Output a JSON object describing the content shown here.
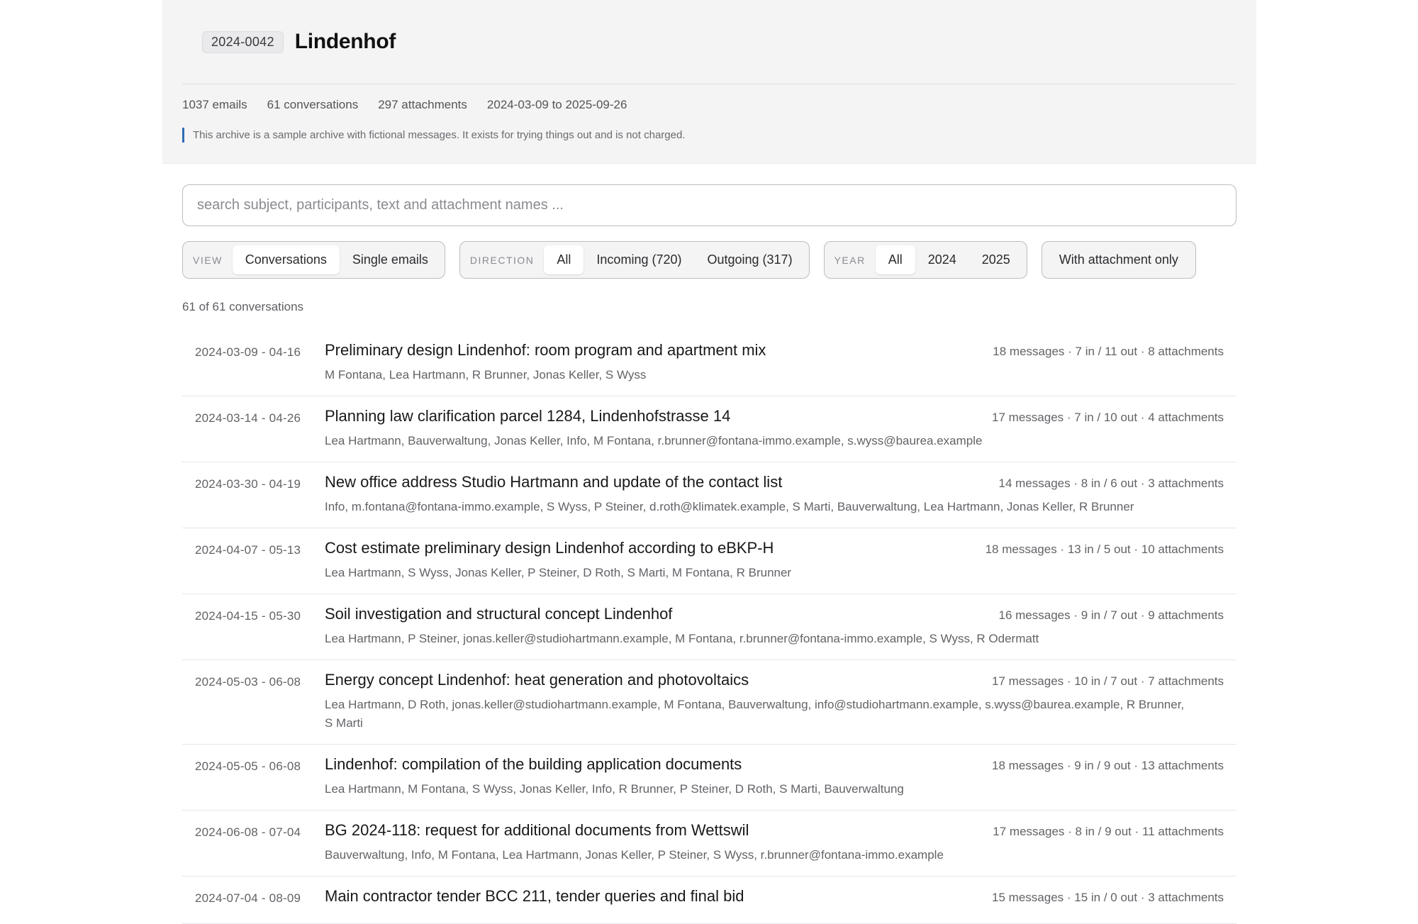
{
  "header": {
    "case_id": "2024-0042",
    "title": "Lindenhof",
    "stats": {
      "emails": "1037 emails",
      "conversations": "61 conversations",
      "attachments": "297 attachments",
      "range": "2024-03-09 to 2025-09-26"
    },
    "notice": "This archive is a sample archive with fictional messages. It exists for trying things out and is not charged."
  },
  "search": {
    "placeholder": "search subject, participants, text and attachment names ...",
    "value": ""
  },
  "filters": {
    "view": {
      "label": "VIEW",
      "options": [
        "Conversations",
        "Single emails"
      ],
      "selected": "Conversations"
    },
    "direction": {
      "label": "DIRECTION",
      "options": [
        "All",
        "Incoming (720)",
        "Outgoing (317)"
      ],
      "selected": "All"
    },
    "year": {
      "label": "YEAR",
      "options": [
        "All",
        "2024",
        "2025"
      ],
      "selected": "All"
    },
    "attachment_toggle": "With attachment only"
  },
  "result_count": "61 of 61 conversations",
  "conversations": [
    {
      "date": "2024-03-09 - 04-16",
      "subject": "Preliminary design Lindenhof: room program and apartment mix",
      "meta": "18 messages · 7 in / 11 out · 8 attachments",
      "participants": "M Fontana, Lea Hartmann, R Brunner, Jonas Keller, S Wyss"
    },
    {
      "date": "2024-03-14 - 04-26",
      "subject": "Planning law clarification parcel 1284, Lindenhofstrasse 14",
      "meta": "17 messages · 7 in / 10 out · 4 attachments",
      "participants": "Lea Hartmann, Bauverwaltung, Jonas Keller, Info, M Fontana, r.brunner@fontana-immo.example, s.wyss@baurea.example"
    },
    {
      "date": "2024-03-30 - 04-19",
      "subject": "New office address Studio Hartmann and update of the contact list",
      "meta": "14 messages · 8 in / 6 out · 3 attachments",
      "participants": "Info, m.fontana@fontana-immo.example, S Wyss, P Steiner, d.roth@klimatek.example, S Marti, Bauverwaltung, Lea Hartmann, Jonas Keller, R Brunner"
    },
    {
      "date": "2024-04-07 - 05-13",
      "subject": "Cost estimate preliminary design Lindenhof according to eBKP-H",
      "meta": "18 messages · 13 in / 5 out · 10 attachments",
      "participants": "Lea Hartmann, S Wyss, Jonas Keller, P Steiner, D Roth, S Marti, M Fontana, R Brunner"
    },
    {
      "date": "2024-04-15 - 05-30",
      "subject": "Soil investigation and structural concept Lindenhof",
      "meta": "16 messages · 9 in / 7 out · 9 attachments",
      "participants": "Lea Hartmann, P Steiner, jonas.keller@studiohartmann.example, M Fontana, r.brunner@fontana-immo.example, S Wyss, R Odermatt"
    },
    {
      "date": "2024-05-03 - 06-08",
      "subject": "Energy concept Lindenhof: heat generation and photovoltaics",
      "meta": "17 messages · 10 in / 7 out · 7 attachments",
      "participants": "Lea Hartmann, D Roth, jonas.keller@studiohartmann.example, M Fontana, Bauverwaltung, info@studiohartmann.example, s.wyss@baurea.example, R Brunner, S Marti"
    },
    {
      "date": "2024-05-05 - 06-08",
      "subject": "Lindenhof: compilation of the building application documents",
      "meta": "18 messages · 9 in / 9 out · 13 attachments",
      "participants": "Lea Hartmann, M Fontana, S Wyss, Jonas Keller, Info, R Brunner, P Steiner, D Roth, S Marti, Bauverwaltung"
    },
    {
      "date": "2024-06-08 - 07-04",
      "subject": "BG 2024-118: request for additional documents from Wettswil",
      "meta": "17 messages · 8 in / 9 out · 11 attachments",
      "participants": "Bauverwaltung, Info, M Fontana, Lea Hartmann, Jonas Keller, P Steiner, S Wyss, r.brunner@fontana-immo.example"
    },
    {
      "date": "2024-07-04 - 08-09",
      "subject": "Main contractor tender BCC 211, tender queries and final bid",
      "meta": "15 messages · 15 in / 0 out · 3 attachments",
      "participants": ""
    }
  ]
}
